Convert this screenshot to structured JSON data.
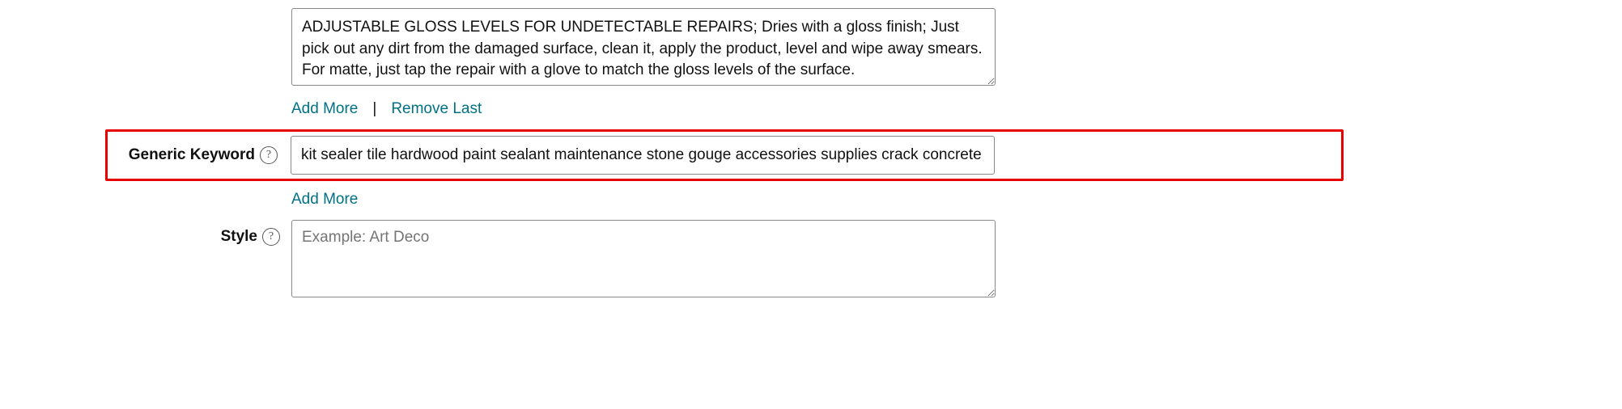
{
  "description": {
    "value": "ADJUSTABLE GLOSS LEVELS FOR UNDETECTABLE REPAIRS; Dries with a gloss finish; Just pick out any dirt from the damaged surface, clean it, apply the product, level and wipe away smears. For matte, just tap the repair with a glove to match the gloss levels of the surface."
  },
  "actions": {
    "add_more": "Add More",
    "remove_last": "Remove Last",
    "separator": "|"
  },
  "generic_keyword": {
    "label": "Generic Keyword",
    "value": "kit sealer tile hardwood paint sealant maintenance stone gouge accessories supplies crack concrete adh"
  },
  "style": {
    "label": "Style",
    "placeholder": "Example: Art Deco"
  },
  "help_glyph": "?"
}
